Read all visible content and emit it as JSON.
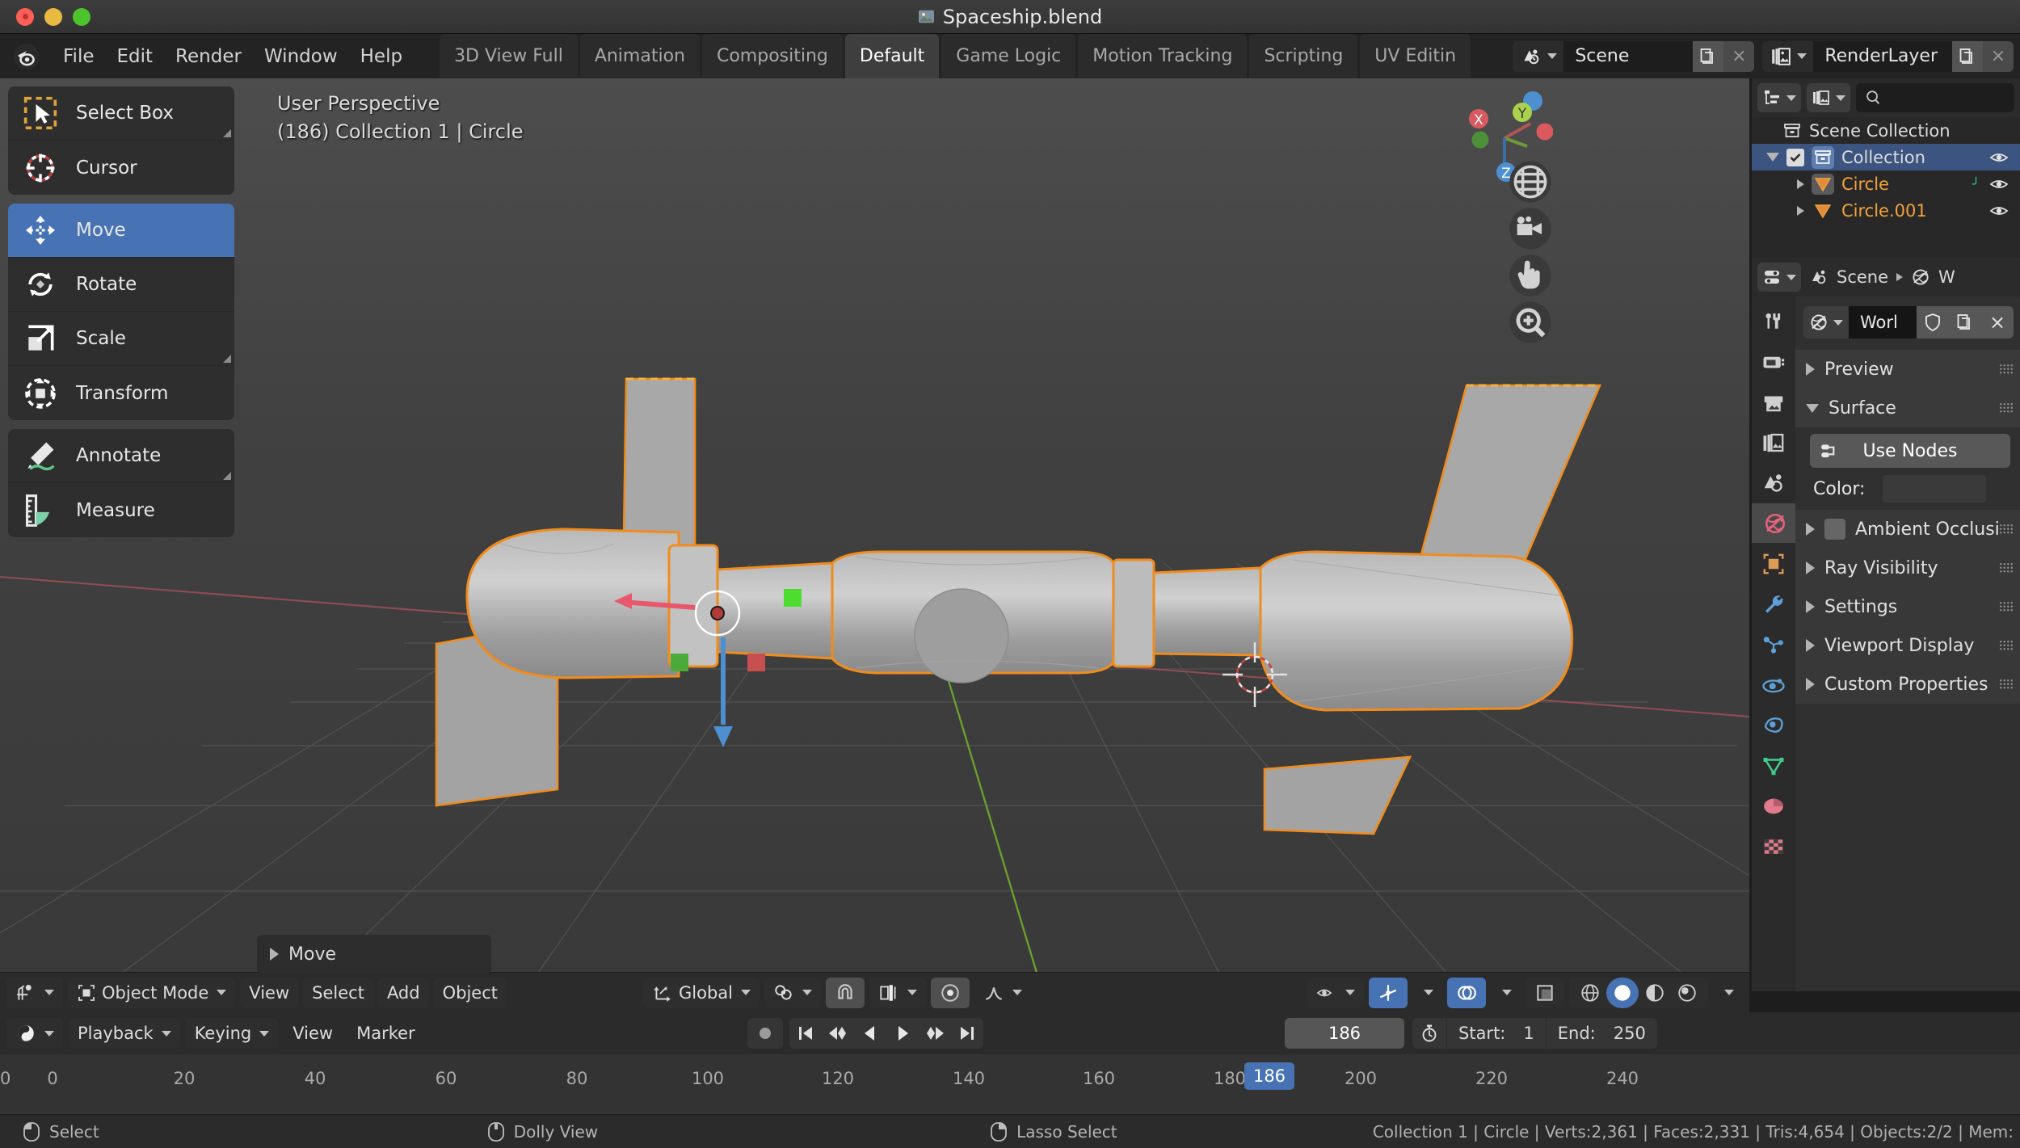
{
  "window": {
    "title": "Spaceship.blend",
    "traffic_lights": [
      "close",
      "minimize",
      "zoom"
    ]
  },
  "topbar": {
    "app_icon": "blender-logo-icon",
    "menus": [
      "File",
      "Edit",
      "Render",
      "Window",
      "Help"
    ],
    "workspaces": [
      {
        "label": "3D View Full",
        "active": false
      },
      {
        "label": "Animation",
        "active": false
      },
      {
        "label": "Compositing",
        "active": false
      },
      {
        "label": "Default",
        "active": true
      },
      {
        "label": "Game Logic",
        "active": false
      },
      {
        "label": "Motion Tracking",
        "active": false
      },
      {
        "label": "Scripting",
        "active": false
      },
      {
        "label": "UV Editin",
        "active": false
      }
    ],
    "scene": {
      "label": "Scene",
      "icon": "scene-icon",
      "new_label": "",
      "close_label": "×"
    },
    "viewlayer": {
      "label": "RenderLayer",
      "icon": "renderlayer-icon",
      "close_label": "×"
    }
  },
  "toolbar": {
    "groups": [
      [
        {
          "label": "Select Box",
          "icon": "select-box-icon",
          "selected": false,
          "has_corner": true
        },
        {
          "label": "Cursor",
          "icon": "cursor-icon",
          "selected": false,
          "has_corner": false
        }
      ],
      [
        {
          "label": "Move",
          "icon": "move-icon",
          "selected": true,
          "has_corner": false
        },
        {
          "label": "Rotate",
          "icon": "rotate-icon",
          "selected": false,
          "has_corner": false
        },
        {
          "label": "Scale",
          "icon": "scale-icon",
          "selected": false,
          "has_corner": true
        },
        {
          "label": "Transform",
          "icon": "transform-icon",
          "selected": false,
          "has_corner": false
        }
      ],
      [
        {
          "label": "Annotate",
          "icon": "annotate-icon",
          "selected": false,
          "has_corner": true
        },
        {
          "label": "Measure",
          "icon": "measure-icon",
          "selected": false,
          "has_corner": false
        }
      ]
    ]
  },
  "viewport": {
    "view_name": "User Perspective",
    "object_info": "(186) Collection 1 | Circle",
    "gizmo_axes": [
      {
        "label": "X",
        "color": "#e3666c"
      },
      {
        "label": "Y",
        "color": "#a9d14b"
      },
      {
        "label": "Z",
        "color": "#4d8fd1"
      }
    ],
    "nav_buttons": [
      "zoom-region-icon",
      "camera-view-icon",
      "pan-view-icon",
      "zoom-view-icon"
    ],
    "operator_panel": {
      "label": "Move",
      "icon": "chevron-right-icon"
    }
  },
  "viewport_footer": {
    "editor_type_icon": "editor-type-3dview-icon",
    "mode": "Object Mode",
    "mode_icon": "object-mode-icon",
    "menus": [
      "View",
      "Select",
      "Add",
      "Object"
    ],
    "transform_orientation": {
      "label": "Global",
      "icon": "orientation-icon"
    },
    "pivot_icon": "pivot-point-icon",
    "snap_icon": "magnet-icon",
    "snap_target_icon": "snap-increment-icon",
    "proportional_icon": "proportional-edit-icon",
    "falloff_icon": "smooth-falloff-icon",
    "overlay_icons": [
      "visibility-icon",
      "xray-icon",
      "overlays-icon",
      "gizmo-icon"
    ],
    "shading_modes": [
      "wireframe-shading",
      "solid-shading",
      "material-shading",
      "rendered-shading"
    ],
    "shading_active_index": 1
  },
  "outliner": {
    "display_mode_icon": "outliner-display-mode-icon",
    "filter_icon": "filter-icon",
    "search_placeholder": "",
    "search_icon": "search-icon",
    "rows": [
      {
        "label": "Scene Collection",
        "icon": "collection-icon",
        "indent": 0,
        "selected": false,
        "orange": false,
        "expander": "none",
        "checkbox": false,
        "eye": false
      },
      {
        "label": "Collection",
        "icon": "collection-icon",
        "indent": 1,
        "selected": true,
        "orange": false,
        "expander": "down",
        "checkbox": true,
        "eye": true
      },
      {
        "label": "Circle",
        "icon": "mesh-icon",
        "indent": 2,
        "selected": false,
        "orange": true,
        "expander": "right",
        "checkbox": false,
        "eye": true
      },
      {
        "label": "Circle.001",
        "icon": "mesh-icon",
        "indent": 2,
        "selected": false,
        "orange": true,
        "expander": "right",
        "checkbox": false,
        "eye": true
      }
    ]
  },
  "properties": {
    "editor_icon": "properties-editor-icon",
    "breadcrumb": [
      {
        "label": "Scene",
        "icon": "scene-icon"
      },
      {
        "label": "W",
        "icon": "world-icon"
      }
    ],
    "tabs": [
      {
        "name": "tool-tab",
        "icon": "tool-icon",
        "color": "#cfcfcf",
        "active": false
      },
      {
        "name": "render-tab",
        "icon": "render-icon",
        "color": "#cfcfcf",
        "active": false
      },
      {
        "name": "output-tab",
        "icon": "output-icon",
        "color": "#cfcfcf",
        "active": false
      },
      {
        "name": "viewlayer-tab",
        "icon": "viewlayer-icon",
        "color": "#cfcfcf",
        "active": false
      },
      {
        "name": "scene-tab",
        "icon": "scene-icon",
        "color": "#cfcfcf",
        "active": false
      },
      {
        "name": "world-tab",
        "icon": "world-icon",
        "color": "#e8637f",
        "active": true
      },
      {
        "name": "object-tab",
        "icon": "object-icon",
        "color": "#dd9b55",
        "active": false
      },
      {
        "name": "modifier-tab",
        "icon": "wrench-icon",
        "color": "#5e9fd8",
        "active": false
      },
      {
        "name": "particles-tab",
        "icon": "particles-icon",
        "color": "#5e9fd8",
        "active": false
      },
      {
        "name": "physics-tab",
        "icon": "physics-icon",
        "color": "#5e9fd8",
        "active": false
      },
      {
        "name": "constraints-tab",
        "icon": "constraints-icon",
        "color": "#5e9fd8",
        "active": false
      },
      {
        "name": "data-tab",
        "icon": "mesh-data-icon",
        "color": "#3ecf8e",
        "active": false
      },
      {
        "name": "material-tab",
        "icon": "material-icon",
        "color": "#e07a8c",
        "active": false
      },
      {
        "name": "texture-tab",
        "icon": "texture-icon",
        "color": "#e07a8c",
        "active": false
      }
    ],
    "world_id": {
      "name": "Worl",
      "icon": "world-icon",
      "shield_icon": "fake-user-icon",
      "new_icon": "new-datablock-icon",
      "unlink_label": "×"
    },
    "panels": [
      {
        "label": "Preview",
        "open": false,
        "checkbox": false
      },
      {
        "label": "Surface",
        "open": true,
        "checkbox": false
      },
      {
        "label": "Ambient Occlusi",
        "open": false,
        "checkbox": true
      },
      {
        "label": "Ray Visibility",
        "open": false,
        "checkbox": false
      },
      {
        "label": "Settings",
        "open": false,
        "checkbox": false
      },
      {
        "label": "Viewport Display",
        "open": false,
        "checkbox": false
      },
      {
        "label": "Custom Properties",
        "open": false,
        "checkbox": false
      }
    ],
    "use_nodes_label": "Use Nodes",
    "use_nodes_icon": "nodetree-icon",
    "color_label": "Color:"
  },
  "timeline": {
    "editor_icon": "timeline-editor-icon",
    "menus": [
      {
        "label": "Playback",
        "dropdown": true
      },
      {
        "label": "Keying",
        "dropdown": true
      },
      {
        "label": "View",
        "dropdown": false
      },
      {
        "label": "Marker",
        "dropdown": false
      }
    ],
    "record_icon": "auto-keying-icon",
    "transport": [
      "jump-to-start-icon",
      "jump-prev-keyframe-icon",
      "play-reverse-icon",
      "play-icon",
      "jump-next-keyframe-icon",
      "jump-to-end-icon"
    ],
    "current_frame": "186",
    "timer_icon": "use-preview-range-icon",
    "start_label": "Start:",
    "start_value": "1",
    "end_label": "End:",
    "end_value": "250",
    "ticks": [
      "0",
      "20",
      "40",
      "60",
      "80",
      "100",
      "120",
      "140",
      "160",
      "180",
      "200",
      "220",
      "240"
    ],
    "playhead_label": "186",
    "playhead_color": "#3b74c4"
  },
  "statusbar": {
    "hints": [
      {
        "icon": "mouse-left-icon",
        "label": "Select"
      },
      {
        "icon": "mouse-middle-icon",
        "label": "Dolly View"
      },
      {
        "icon": "mouse-right-icon",
        "label": "Lasso Select"
      }
    ],
    "stats": "Collection 1 | Circle | Verts:2,361 | Faces:2,331 | Tris:4,654 | Objects:2/2 | Mem:"
  },
  "colors": {
    "accent_blue": "#4772b3",
    "select_orange": "#f2a13c",
    "world_pink": "#e8637f",
    "bg_dark": "#232323",
    "bg_panel": "#303030"
  }
}
